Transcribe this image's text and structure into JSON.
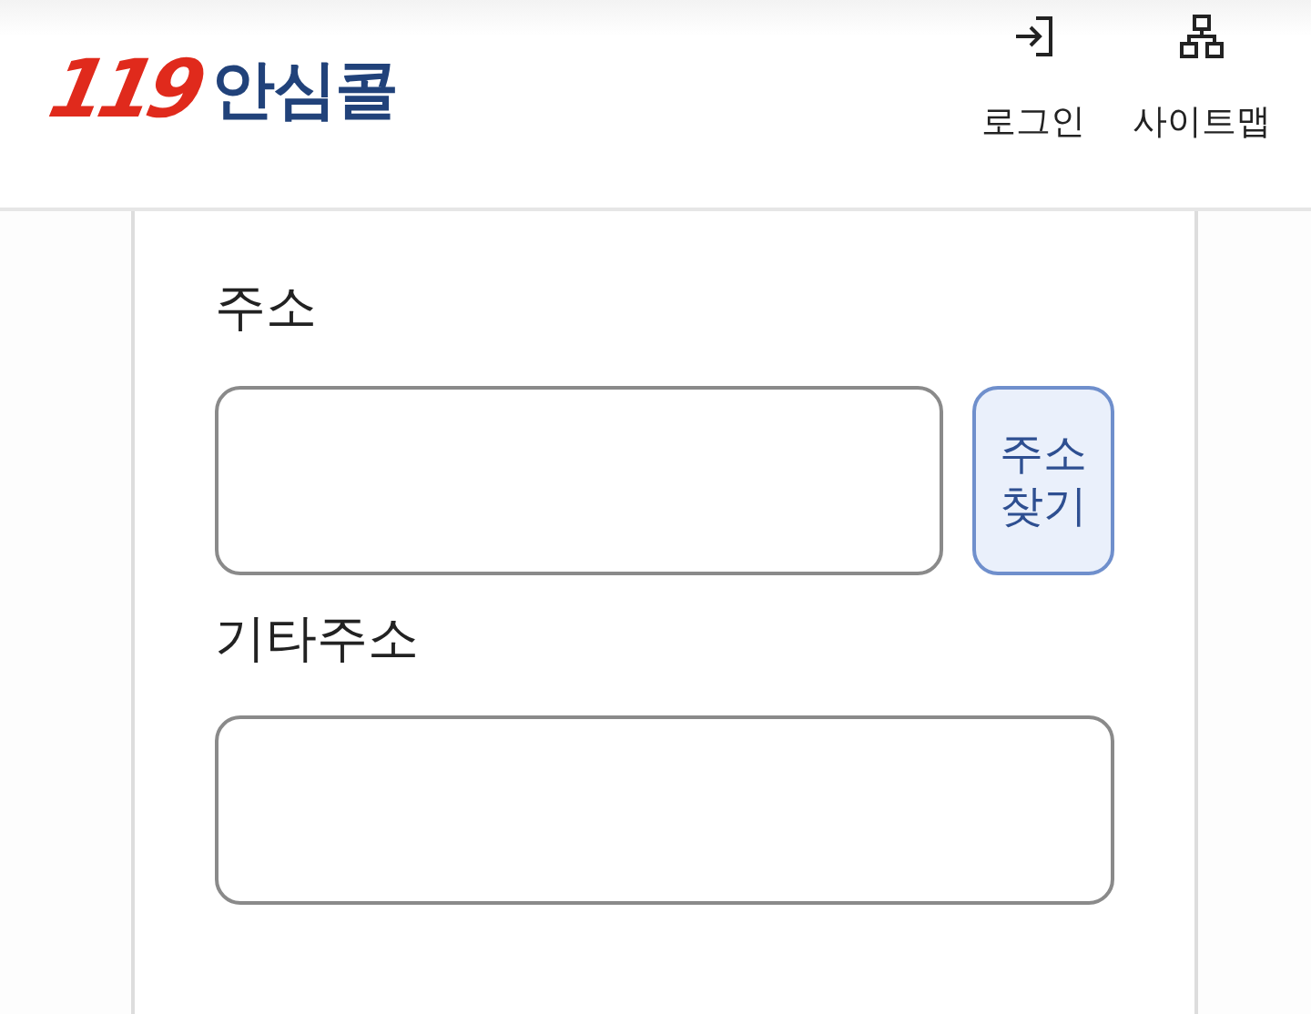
{
  "header": {
    "logo": {
      "number": "119",
      "name": "안심콜"
    },
    "actions": [
      {
        "kind": "login",
        "label": "로그인"
      },
      {
        "kind": "sitemap",
        "label": "사이트맵"
      }
    ]
  },
  "form": {
    "fields": [
      {
        "label": "주소",
        "button": "주소\n찾기"
      },
      {
        "label": "기타주소"
      }
    ]
  }
}
